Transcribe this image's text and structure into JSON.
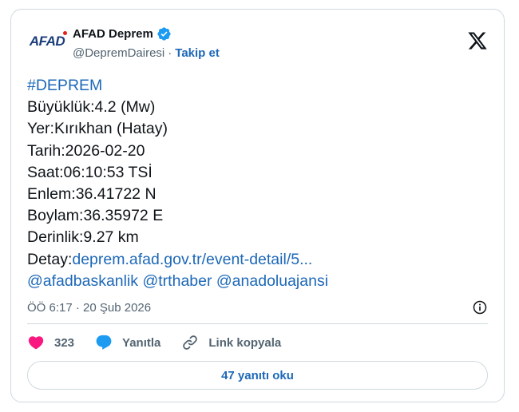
{
  "colors": {
    "link": "#1d68b8",
    "verified": "#1d9bf0",
    "heart": "#f91880",
    "border": "#cfd9de",
    "muted": "#536471"
  },
  "account": {
    "logo_text": "AFAD",
    "display_name": "AFAD Deprem",
    "handle": "@DepremDairesi",
    "separator": "·",
    "follow_label": "Takip et"
  },
  "tweet": {
    "hashtag": "#DEPREM",
    "lines": [
      "Büyüklük:4.2 (Mw)",
      "Yer:Kırıkhan (Hatay)",
      "Tarih:2026-02-20",
      "Saat:06:10:53 TSİ",
      "Enlem:36.41722 N",
      "Boylam:36.35972 E",
      "Derinlik:9.27 km"
    ],
    "detail_label": "Detay:",
    "detail_link": "deprem.afad.gov.tr/event-detail/5...",
    "mentions": [
      "@afadbaskanlik",
      "@trthaber",
      "@anadoluajansi"
    ],
    "timestamp": "ÖÖ 6:17 · 20 Şub 2026"
  },
  "actions": {
    "like_count": "323",
    "reply_label": "Yanıtla",
    "copy_link_label": "Link kopyala"
  },
  "replies_button": "47 yanıtı oku",
  "icons": [
    "verified-badge-icon",
    "x-logo-icon",
    "info-icon",
    "heart-icon",
    "reply-bubble-icon",
    "link-icon"
  ]
}
